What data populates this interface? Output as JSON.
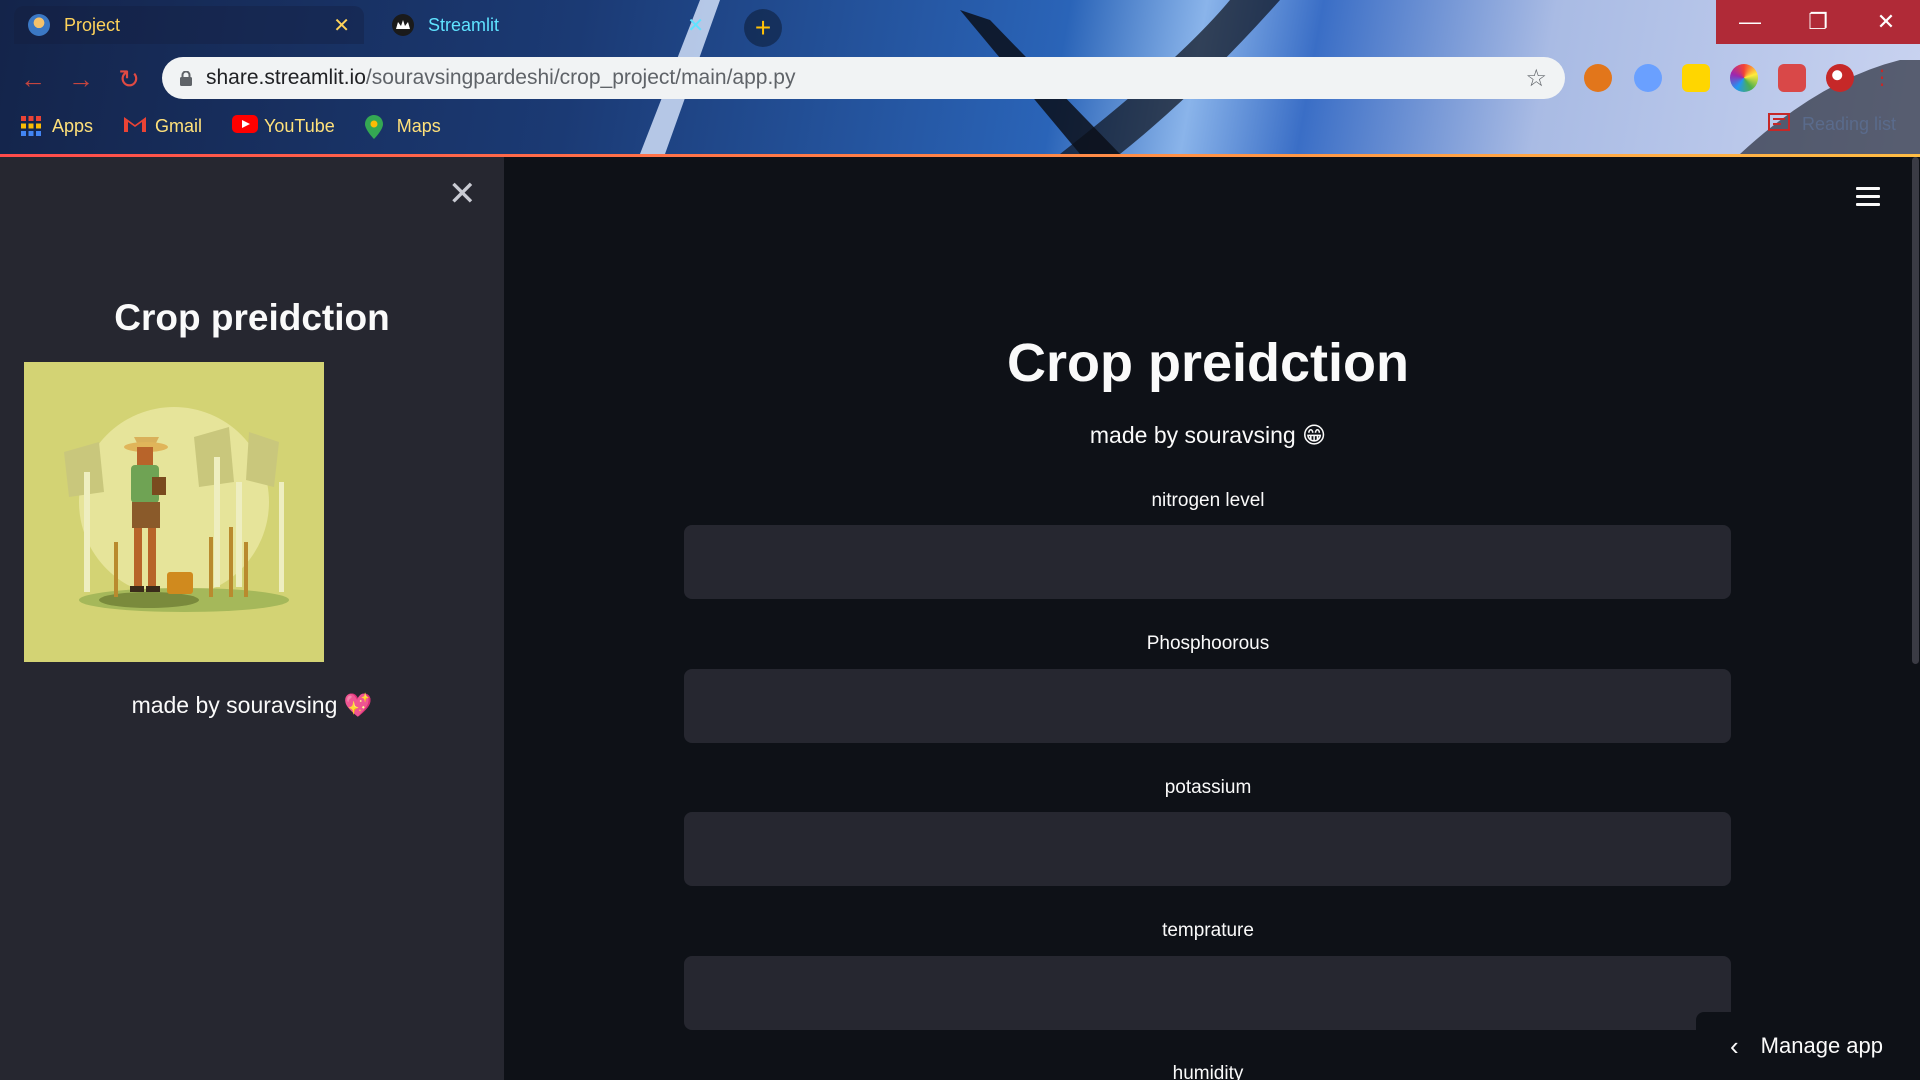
{
  "browser": {
    "tabs": [
      {
        "title": "Project",
        "close": "✕"
      },
      {
        "title": "Streamlit",
        "close": "✕"
      }
    ],
    "new_tab": "+",
    "window_controls": {
      "minimize": "—",
      "maximize": "❐",
      "close": "✕"
    },
    "nav": {
      "back": "←",
      "forward": "→",
      "reload": "↻"
    },
    "address": {
      "host": "share.streamlit.io",
      "path": "/souravsingpardeshi/crop_project/main/app.py"
    },
    "star": "☆",
    "bookmarks": [
      {
        "label": "Apps",
        "icon": "apps-grid-icon"
      },
      {
        "label": "Gmail",
        "icon": "gmail-icon"
      },
      {
        "label": "YouTube",
        "icon": "youtube-icon"
      },
      {
        "label": "Maps",
        "icon": "maps-icon"
      }
    ],
    "reading_list": "Reading list"
  },
  "sidebar": {
    "close": "✕",
    "title": "Crop preidction",
    "made_by": "made by souravsing 💖"
  },
  "main": {
    "title": "Crop preidction",
    "subtitle": "made by souravsing 😁",
    "fields": [
      {
        "label": "nitrogen level",
        "value": ""
      },
      {
        "label": "Phosphoorous",
        "value": ""
      },
      {
        "label": "potassium",
        "value": ""
      },
      {
        "label": "temprature",
        "value": ""
      },
      {
        "label": "humidity",
        "value": ""
      }
    ]
  },
  "manage_app": {
    "chevron": "‹",
    "label": "Manage app"
  },
  "colors": {
    "accent": "#ff4b4b",
    "sidebar_bg": "#262730",
    "main_bg": "#0e1117",
    "input_bg": "#262730",
    "text": "#fafafa"
  }
}
